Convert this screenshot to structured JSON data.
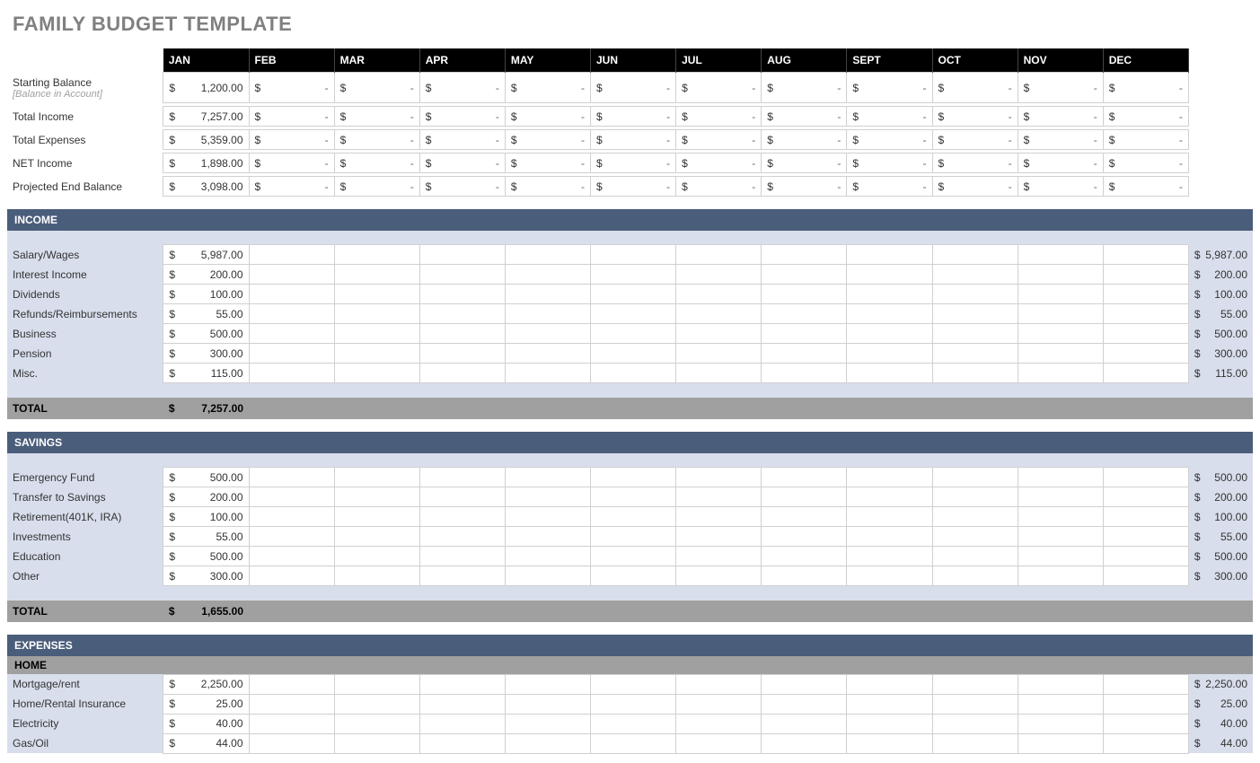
{
  "title": "FAMILY BUDGET TEMPLATE",
  "months": [
    "JAN",
    "FEB",
    "MAR",
    "APR",
    "MAY",
    "JUN",
    "JUL",
    "AUG",
    "SEPT",
    "OCT",
    "NOV",
    "DEC"
  ],
  "summary": {
    "starting_balance_label": "Starting Balance",
    "starting_balance_sub": "[Balance in Account]",
    "rows": [
      {
        "label": "Starting Balance",
        "jan": "1,200.00"
      },
      {
        "label": "Total Income",
        "jan": "7,257.00"
      },
      {
        "label": "Total Expenses",
        "jan": "5,359.00"
      },
      {
        "label": "NET Income",
        "jan": "1,898.00"
      },
      {
        "label": "Projected End Balance",
        "jan": "3,098.00"
      }
    ]
  },
  "sections": [
    {
      "title": "INCOME",
      "rows": [
        {
          "label": "Salary/Wages",
          "jan": "5,987.00",
          "total": "5,987.00"
        },
        {
          "label": "Interest Income",
          "jan": "200.00",
          "total": "200.00"
        },
        {
          "label": "Dividends",
          "jan": "100.00",
          "total": "100.00"
        },
        {
          "label": "Refunds/Reimbursements",
          "jan": "55.00",
          "total": "55.00"
        },
        {
          "label": "Business",
          "jan": "500.00",
          "total": "500.00"
        },
        {
          "label": "Pension",
          "jan": "300.00",
          "total": "300.00"
        },
        {
          "label": "Misc.",
          "jan": "115.00",
          "total": "115.00"
        }
      ],
      "total_label": "TOTAL",
      "total_jan": "7,257.00"
    },
    {
      "title": "SAVINGS",
      "rows": [
        {
          "label": "Emergency Fund",
          "jan": "500.00",
          "total": "500.00"
        },
        {
          "label": "Transfer to Savings",
          "jan": "200.00",
          "total": "200.00"
        },
        {
          "label": "Retirement(401K, IRA)",
          "jan": "100.00",
          "total": "100.00"
        },
        {
          "label": "Investments",
          "jan": "55.00",
          "total": "55.00"
        },
        {
          "label": "Education",
          "jan": "500.00",
          "total": "500.00"
        },
        {
          "label": "Other",
          "jan": "300.00",
          "total": "300.00"
        }
      ],
      "total_label": "TOTAL",
      "total_jan": "1,655.00"
    },
    {
      "title": "EXPENSES",
      "subsection": "HOME",
      "rows": [
        {
          "label": "Mortgage/rent",
          "jan": "2,250.00",
          "total": "2,250.00"
        },
        {
          "label": "Home/Rental Insurance",
          "jan": "25.00",
          "total": "25.00"
        },
        {
          "label": "Electricity",
          "jan": "40.00",
          "total": "40.00"
        },
        {
          "label": "Gas/Oil",
          "jan": "44.00",
          "total": "44.00"
        }
      ]
    }
  ],
  "currency": "$",
  "dash": "-"
}
